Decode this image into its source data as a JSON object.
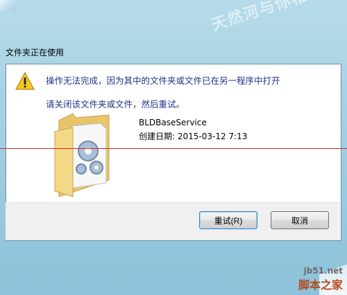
{
  "window": {
    "title": "文件夹正在使用"
  },
  "dialog": {
    "message_primary": "操作无法完成，因为其中的文件夹或文件已在另一程序中打开",
    "message_secondary": "请关闭该文件夹或文件，然后重试。",
    "item": {
      "name": "BLDBaseService",
      "created_label": "创建日期: 2015-03-12 7:13"
    },
    "buttons": {
      "retry": "重试(R)",
      "cancel": "取消"
    }
  },
  "watermarks": {
    "top": "天然河与你相约",
    "site": "jb51.net",
    "brand": "脚本之家"
  },
  "icons": {
    "warning": "warning-triangle-icon",
    "folder": "folder-with-gears-icon",
    "close": "close-icon"
  },
  "colors": {
    "message_text": "#1e3287",
    "frame": "#a4d0e3",
    "annotation_line": "#c92b2b"
  }
}
